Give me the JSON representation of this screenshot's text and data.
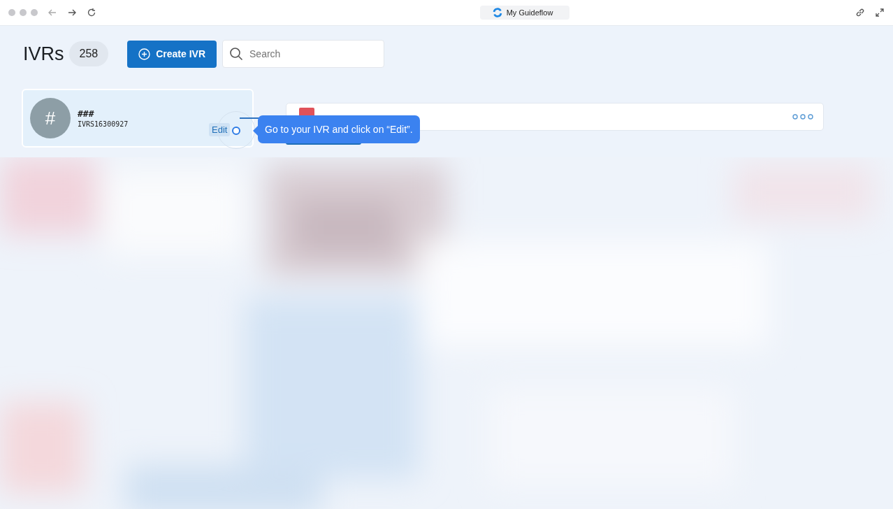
{
  "browser": {
    "tab_title": "My Guideflow"
  },
  "header": {
    "title": "IVRs",
    "count": "258",
    "create_button": "Create IVR",
    "search": {
      "placeholder": "Search"
    }
  },
  "ivr": {
    "avatar": "#",
    "name": "###",
    "code": "IVRS16300927",
    "edit": "Edit"
  },
  "tooltip": {
    "text": "Go to your IVR and click on “Edit”."
  }
}
